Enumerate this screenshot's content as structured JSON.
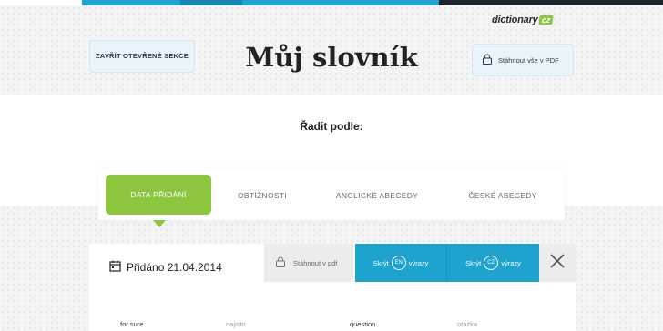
{
  "colors": {
    "accent_blue": "#1ea3cf",
    "accent_green": "#8cc63f",
    "dark_strip": "#1c2430",
    "button_bg": "#e9f4fa"
  },
  "logo": {
    "text": "dictionary",
    "badge": "cz"
  },
  "header": {
    "close_sections_label": "ZAVŘÍT OTEVŘENÉ SEKCE",
    "title": "Můj slovník",
    "download_all_label": "Stáhnout vše v PDF",
    "download_icon": "lock-icon"
  },
  "sort": {
    "label": "Řadit podle:",
    "tabs": [
      {
        "label": "DATA PŘIDÁNÍ",
        "active": true
      },
      {
        "label": "OBTÍŽNOSTI",
        "active": false
      },
      {
        "label": "ANGLICKÉ ABECEDY",
        "active": false
      },
      {
        "label": "ČESKÉ ABECEDY",
        "active": false
      }
    ]
  },
  "card": {
    "added_label": "Přidáno 21.04.2014",
    "calendar_icon": "calendar-icon",
    "download_pdf_label": "Stáhnout v pdf",
    "hide_en": {
      "prefix": "Skrýt",
      "badge": "EN",
      "suffix": "výrazy"
    },
    "hide_cz": {
      "prefix": "Skrýt",
      "badge": "CZ",
      "suffix": "výrazy"
    },
    "close_icon": "close-icon",
    "rows": [
      {
        "en": "for sure",
        "cz": "najisto"
      },
      {
        "en": "question",
        "cz": "otázka"
      }
    ]
  }
}
